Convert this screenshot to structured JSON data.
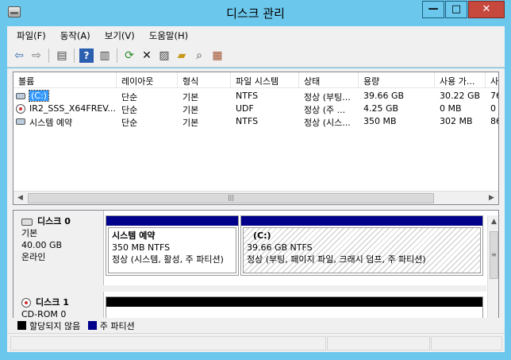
{
  "window": {
    "title": "디스크 관리",
    "minimize": "—",
    "maximize": "□",
    "close": "✕"
  },
  "menu": [
    "파일(F)",
    "동작(A)",
    "보기(V)",
    "도움말(H)"
  ],
  "toolbar_icons": [
    "back-arrow",
    "forward-arrow",
    "show-hide-console-tree",
    "help",
    "properties",
    "refresh",
    "delete",
    "properties-sheet",
    "open",
    "explore",
    "settings"
  ],
  "columns": [
    "볼륨",
    "레이아웃",
    "형식",
    "파일 시스템",
    "상태",
    "용량",
    "사용 가...",
    "사"
  ],
  "volumes": [
    {
      "name": "(C:)",
      "layout": "단순",
      "type": "기본",
      "fs": "NTFS",
      "status": "정상 (부팅...",
      "capacity": "39.66 GB",
      "free": "30.22 GB",
      "pct": "76"
    },
    {
      "name": "IR2_SSS_X64FREV...",
      "layout": "단순",
      "type": "기본",
      "fs": "UDF",
      "status": "정상 (주 ...",
      "capacity": "4.25 GB",
      "free": "0 MB",
      "pct": "0"
    },
    {
      "name": "시스템 예약",
      "layout": "단순",
      "type": "기본",
      "fs": "NTFS",
      "status": "정상 (시스...",
      "capacity": "350 MB",
      "free": "302 MB",
      "pct": "86"
    }
  ],
  "disk0": {
    "name": "디스크 0",
    "type": "기본",
    "size": "40.00 GB",
    "state": "온라인",
    "partitions": [
      {
        "title": "시스템 예약",
        "size": "350 MB NTFS",
        "status": "정상 (시스템, 활성, 주 파티션)"
      },
      {
        "title": "(C:)",
        "size": "39.66 GB NTFS",
        "status": "정상 (부팅, 페이지 파일, 크래시 덤프, 주 파티션)"
      }
    ]
  },
  "disk1": {
    "name": "디스크 1",
    "state": "CD-ROM 0"
  },
  "legend": [
    {
      "label": "할당되지 않음",
      "color": "#000000"
    },
    {
      "label": "주 파티션",
      "color": "#00008b"
    }
  ],
  "colors": {
    "titlebar": "#6cc7ec",
    "close": "#c7483c",
    "primary_partition": "#00008b",
    "unallocated": "#000000"
  }
}
